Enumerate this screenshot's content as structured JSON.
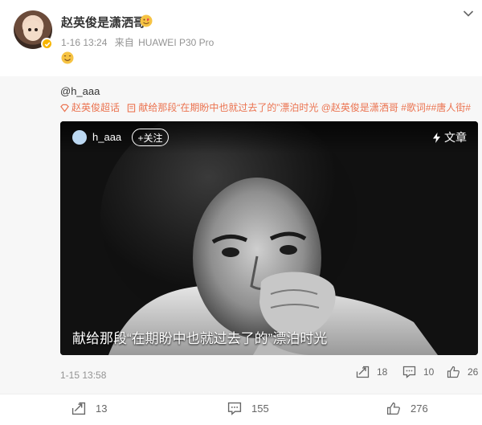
{
  "post": {
    "username": "赵英俊是潇洒哥",
    "time": "1-16 13:24",
    "source_prefix": "来自",
    "source": "HUAWEI P30 Pro"
  },
  "quoted": {
    "user": "@h_aaa",
    "text_parts": {
      "supertopic": "赵英俊超话",
      "prefix": "献给那段“在期盼中也就过去了的”漂泊时光",
      "mention": "@赵英俊是潇洒哥",
      "tags": "#歌词##唐人街#"
    },
    "video": {
      "author": "h_aaa",
      "follow_label": "+关注",
      "article_label": "文章",
      "caption": "献给那段“在期盼中也就过去了的”漂泊时光"
    },
    "time": "1-15 13:58",
    "reposts": "18",
    "comments": "10",
    "likes": "26"
  },
  "actions": {
    "reposts": "13",
    "comments": "155",
    "likes": "276"
  },
  "colors": {
    "accent": "#eb7350",
    "meta": "#939393",
    "quote_bg": "#f7f7f7"
  }
}
